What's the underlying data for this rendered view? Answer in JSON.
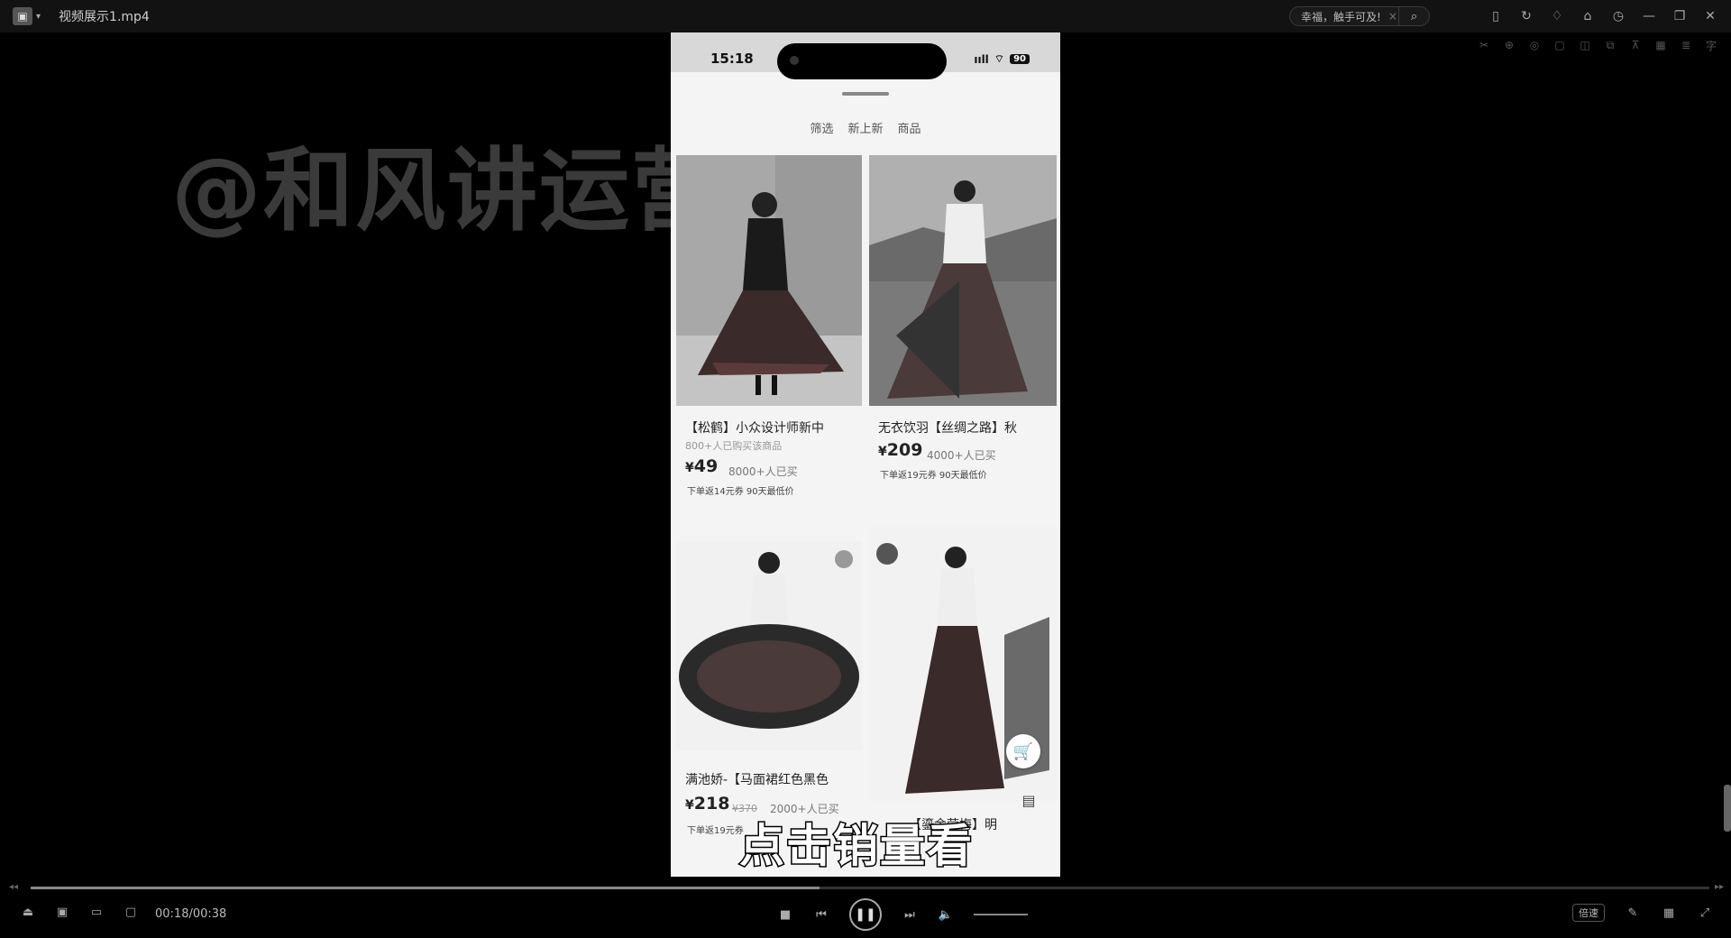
{
  "window": {
    "app_icon": "player-app-icon",
    "title": "视频展示1.mp4",
    "search_placeholder": "幸福，触手可及!",
    "search_clear": "×",
    "search_glyph": "⌕"
  },
  "titlebar_icons": [
    {
      "name": "skin-icon",
      "glyph": "▯"
    },
    {
      "name": "refresh-icon",
      "glyph": "↻"
    },
    {
      "name": "share-icon",
      "glyph": "♢"
    },
    {
      "name": "tshirt-icon",
      "glyph": "⌂"
    },
    {
      "name": "clock-icon",
      "glyph": "◷"
    },
    {
      "name": "minimize-icon",
      "glyph": "—"
    },
    {
      "name": "restore-icon",
      "glyph": "❐"
    },
    {
      "name": "close-icon",
      "glyph": "✕"
    }
  ],
  "watermark": "@和风讲运营",
  "phone": {
    "time": "15:18",
    "signal": "ııll",
    "wifi": "⌔",
    "battery": "90",
    "filters": [
      "筛选",
      "新上新",
      "商品"
    ]
  },
  "products": [
    {
      "title": "【松鹤】小众设计师新中",
      "subtitle": "800+人已购买该商品",
      "currency": "¥",
      "price": "49",
      "sold": "8000+人已买",
      "promo": "下单返14元券   90天最低价"
    },
    {
      "title": "无衣饮羽【丝绸之路】秋",
      "currency": "¥",
      "price": "209",
      "sold": "4000+人已买",
      "promo": "下单返19元券   90天最低价"
    },
    {
      "title": "满池娇-【马面裙红色黑色",
      "currency": "¥",
      "price": "218",
      "original_price": "¥370",
      "sold": "2000+人已买",
      "promo": "下单返19元券"
    },
    {
      "title": "【鎏金莹梅】明"
    }
  ],
  "caption": "点击销量看",
  "player": {
    "timecode": "00:18/00:38",
    "progress": 0.47,
    "speed_label": "倍速",
    "seek_back": "◂◂",
    "seek_fwd": "▸▸"
  }
}
